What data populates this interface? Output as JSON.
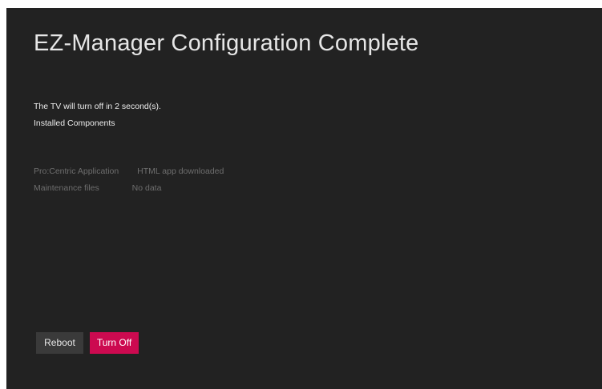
{
  "dialog": {
    "title": "EZ-Manager Configuration Complete",
    "countdown_text": "The TV will turn off in 2 second(s).",
    "components_heading": "Installed Components"
  },
  "components": [
    {
      "name": "Pro:Centric Application",
      "status": "HTML app downloaded"
    },
    {
      "name": "Maintenance files",
      "status": "No data"
    }
  ],
  "buttons": {
    "reboot_label": "Reboot",
    "turn_off_label": "Turn Off"
  },
  "colors": {
    "background": "#222222",
    "accent": "#cc0a50",
    "secondary_button": "#3a3a3a"
  }
}
